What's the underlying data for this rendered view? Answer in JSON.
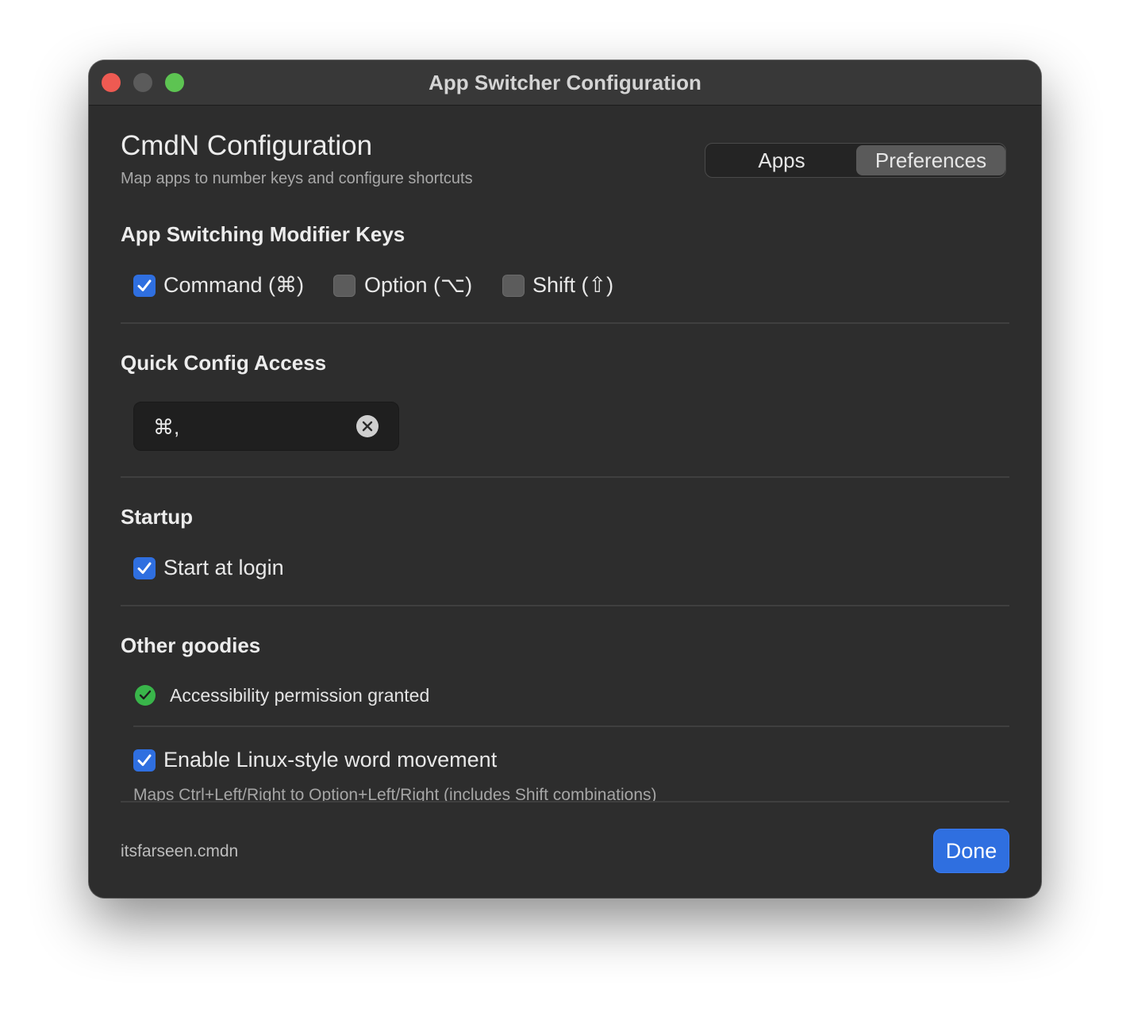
{
  "window": {
    "title": "App Switcher Configuration"
  },
  "header": {
    "title": "CmdN Configuration",
    "subtitle": "Map apps to number keys and configure shortcuts"
  },
  "tabs": [
    {
      "label": "Apps",
      "selected": false
    },
    {
      "label": "Preferences",
      "selected": true
    }
  ],
  "modifier_keys": {
    "title": "App Switching Modifier Keys",
    "options": [
      {
        "label": "Command (⌘)",
        "checked": true
      },
      {
        "label": "Option (⌥)",
        "checked": false
      },
      {
        "label": "Shift (⇧)",
        "checked": false
      }
    ]
  },
  "quick_config": {
    "title": "Quick Config Access",
    "shortcut": "⌘,"
  },
  "startup": {
    "title": "Startup",
    "start_at_login": {
      "label": "Start at login",
      "checked": true
    }
  },
  "other_goodies": {
    "title": "Other goodies",
    "accessibility_status": "Accessibility permission granted",
    "word_movement": {
      "label": "Enable Linux-style word movement",
      "checked": true
    },
    "word_movement_hint": "Maps Ctrl+Left/Right to Option+Left/Right (includes Shift combinations)"
  },
  "footer": {
    "bundle_id": "itsfarseen.cmdn",
    "done_label": "Done"
  },
  "colors": {
    "accent": "#2f6fe0",
    "success": "#39b54a",
    "close": "#ee5a52",
    "maximize": "#5dc452"
  }
}
